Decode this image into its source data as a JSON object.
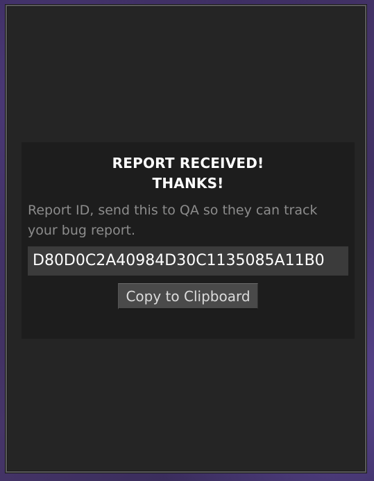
{
  "dialog": {
    "title_line1": "REPORT RECEIVED!",
    "title_line2": "THANKS!",
    "description": "Report ID, send this to QA so they can track your bug report.",
    "report_id": "D80D0C2A40984D30C1135085A11B0",
    "copy_button_label": "Copy to Clipboard"
  }
}
